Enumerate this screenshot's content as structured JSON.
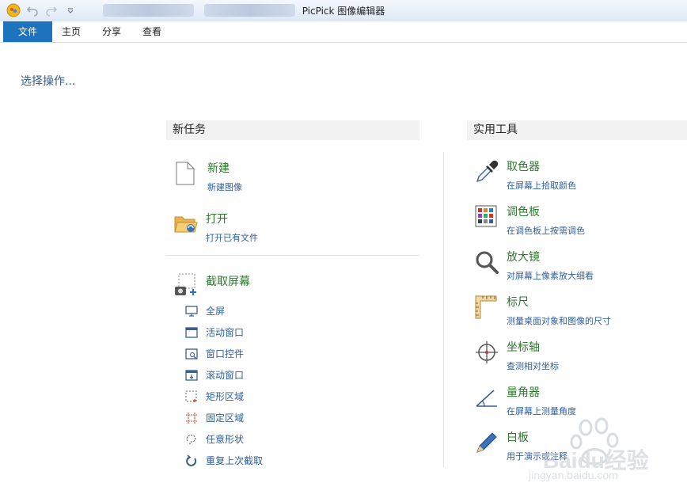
{
  "window": {
    "title": "PicPick 图像编辑器"
  },
  "menu": {
    "file": "文件",
    "home": "主页",
    "share": "分享",
    "view": "查看"
  },
  "prompt": "选择操作...",
  "new_tasks": {
    "header": "新任务",
    "new": {
      "title": "新建",
      "desc": "新建图像"
    },
    "open": {
      "title": "打开",
      "desc": "打开已有文件"
    },
    "capture": {
      "title": "截取屏幕",
      "items": [
        "全屏",
        "活动窗口",
        "窗口控件",
        "滚动窗口",
        "矩形区域",
        "固定区域",
        "任意形状",
        "重复上次截取"
      ]
    }
  },
  "tools": {
    "header": "实用工具",
    "items": [
      {
        "title": "取色器",
        "desc": "在屏幕上拾取颜色"
      },
      {
        "title": "调色板",
        "desc": "在调色板上按需调色"
      },
      {
        "title": "放大镜",
        "desc": "对屏幕上像素放大细看"
      },
      {
        "title": "标尺",
        "desc": "测量桌面对象和图像的尺寸"
      },
      {
        "title": "坐标轴",
        "desc": "查测相对坐标"
      },
      {
        "title": "量角器",
        "desc": "在屏幕上测量角度"
      },
      {
        "title": "白板",
        "desc": "用于演示或注释"
      }
    ]
  },
  "watermark": {
    "brand": "Baidu经验",
    "url": "jingyan.baidu.com"
  },
  "colors": {
    "accent": "#1e73be",
    "title_green": "#2b7a2b",
    "desc_blue": "#2e5f9a"
  }
}
